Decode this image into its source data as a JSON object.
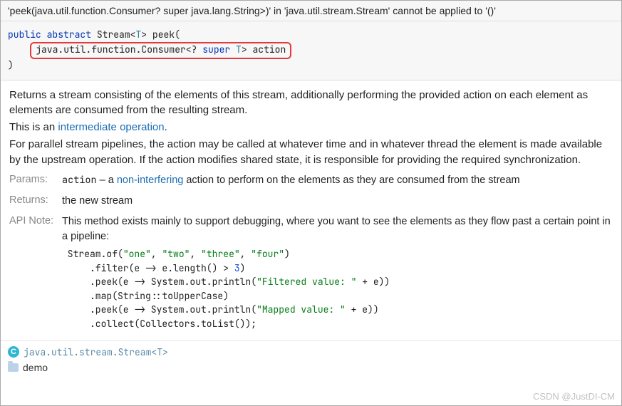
{
  "header": {
    "title": "'peek(java.util.function.Consumer? super java.lang.String>)' in 'java.util.stream.Stream' cannot be applied to '()'"
  },
  "signature": {
    "modifiers_public": "public",
    "modifiers_abstract": "abstract",
    "return_type": "Stream",
    "generic_open": "<",
    "generic_T": "T",
    "generic_close": ">",
    "method_name": "peek",
    "open_paren": "(",
    "param_type_prefix": "java.util.function.Consumer<?",
    "param_super": "super",
    "param_T": "T",
    "param_close": ">",
    "param_name": "action",
    "close_paren": ")"
  },
  "description": {
    "p1": "Returns a stream consisting of the elements of this stream, additionally performing the provided action on each element as elements are consumed from the resulting stream.",
    "p2_prefix": "This is an ",
    "p2_link": "intermediate operation",
    "p2_suffix": ".",
    "p3": "For parallel stream pipelines, the action may be called at whatever time and in whatever thread the element is made available by the upstream operation. If the action modifies shared state, it is responsible for providing the required synchronization."
  },
  "params": {
    "label": "Params:",
    "name": "action",
    "dash": " – a ",
    "link": "non-interfering",
    "rest": " action to perform on the elements as they are consumed from the stream"
  },
  "returns": {
    "label": "Returns:",
    "text": "the new stream"
  },
  "apinote": {
    "label": "API Note:",
    "text": "This method exists mainly to support debugging, where you want to see the elements as they flow past a certain point in a pipeline:",
    "code": {
      "l1a": " Stream.of(",
      "s1": "\"one\"",
      "c1": ", ",
      "s2": "\"two\"",
      "c2": ", ",
      "s3": "\"three\"",
      "c3": ", ",
      "s4": "\"four\"",
      "l1b": ")",
      "l2a": "     .filter(e -> e.length() > ",
      "n1": "3",
      "l2b": ")",
      "l3a": "     .peek(e -> System.out.println(",
      "s5": "\"Filtered value: \"",
      "l3b": " + e))",
      "l4": "     .map(String::toUpperCase)",
      "l5a": "     .peek(e -> System.out.println(",
      "s6": "\"Mapped value: \"",
      "l5b": " + e))",
      "l6": "     .collect(Collectors.toList());"
    }
  },
  "footer": {
    "class_icon": "C",
    "class_path_prefix": "java.util.stream.",
    "class_name": "Stream",
    "class_generic_open": "<",
    "class_T": "T",
    "class_generic_close": ">",
    "module": "demo"
  },
  "watermark": "CSDN @JustDI-CM"
}
